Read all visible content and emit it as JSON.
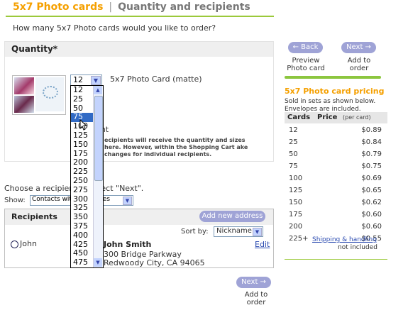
{
  "header": {
    "title_part1": "5x7 Photo cards",
    "separator": "|",
    "title_part2": "Quantity and recipients"
  },
  "question": "How many 5x7 Photo cards would you like to order?",
  "quantity": {
    "title": "Quantity*",
    "selected": "12",
    "product_label": "5x7 Photo Card (matte)",
    "behind_text": "ient",
    "behind_note": "ecipients will receive the quantity and sizes here. However, within the Shopping Cart ake changes for individual recipients.",
    "options": [
      "12",
      "25",
      "50",
      "75",
      "100",
      "125",
      "150",
      "175",
      "200",
      "225",
      "250",
      "275",
      "300",
      "325",
      "350",
      "375",
      "400",
      "425",
      "450",
      "475"
    ],
    "highlighted": "75"
  },
  "recipients_section": {
    "choose_text": "Choose a recipient or select \"Next\".",
    "show_label": "Show:",
    "show_value": "Contacts with addresses",
    "title": "Recipients",
    "add_address_label": "Add new address",
    "sort_label": "Sort by:",
    "sort_value": "Nickname",
    "rows": [
      {
        "nickname": "John",
        "name": "John Smith",
        "address1": "300 Bridge Parkway",
        "address2": "Redwoody City, CA 94065",
        "edit_label": "Edit"
      }
    ]
  },
  "nav": {
    "back_label": "← Back",
    "back_caption": "Preview Photo card",
    "next_label": "Next →",
    "next_caption": "Add to order"
  },
  "pricing": {
    "title": "5x7 Photo card pricing",
    "subtitle": "Sold in sets as shown below. Envelopes are included.",
    "col_cards": "Cards",
    "col_price": "Price",
    "col_per": "(per card)",
    "rows": [
      {
        "qty": "12",
        "price": "$0.89"
      },
      {
        "qty": "25",
        "price": "$0.84"
      },
      {
        "qty": "50",
        "price": "$0.79"
      },
      {
        "qty": "75",
        "price": "$0.75"
      },
      {
        "qty": "100",
        "price": "$0.69"
      },
      {
        "qty": "125",
        "price": "$0.65"
      },
      {
        "qty": "150",
        "price": "$0.62"
      },
      {
        "qty": "175",
        "price": "$0.60"
      },
      {
        "qty": "200",
        "price": "$0.60"
      },
      {
        "qty": "225+",
        "price": "$0.55"
      }
    ],
    "shipping_link": "Shipping & handling",
    "not_included": "not included"
  },
  "colors": {
    "accent_orange": "#f5a000",
    "accent_green": "#8cc63f",
    "button_lavender": "#9fa3d6",
    "selection_blue": "#316ac5"
  }
}
